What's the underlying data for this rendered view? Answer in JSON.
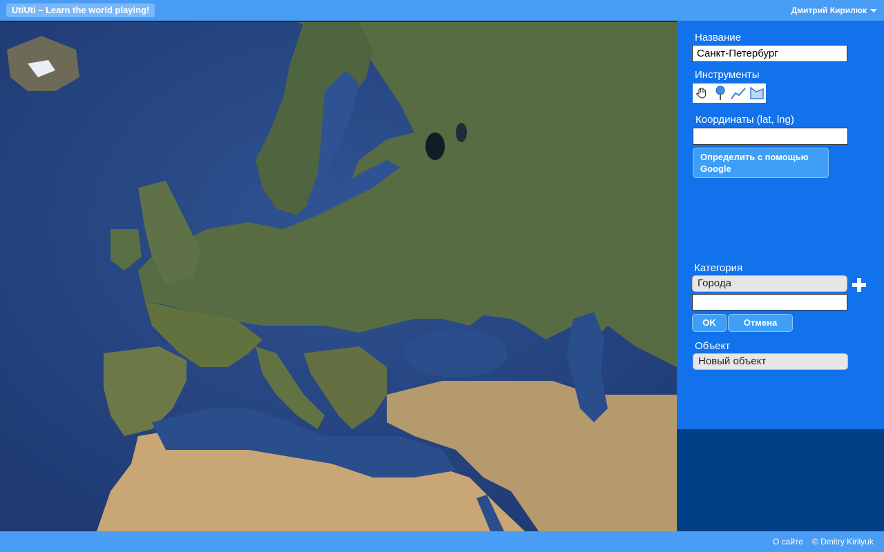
{
  "header": {
    "app_title": "UtiUti – Learn the world playing!",
    "user_name": "Дмитрий Кирилюк"
  },
  "panel": {
    "name_label": "Название",
    "name_value": "Санкт-Петербург",
    "tools_label": "Инструменты",
    "tools": [
      {
        "icon": "hand-icon",
        "label": "pan"
      },
      {
        "icon": "pin-icon",
        "label": "point"
      },
      {
        "icon": "polyline-icon",
        "label": "line"
      },
      {
        "icon": "polygon-icon",
        "label": "area"
      }
    ],
    "coords_label": "Координаты (lat, lng)",
    "coords_value": "",
    "geocode_button": "Определить с помощью Google",
    "category_label": "Категория",
    "category_selected": "Города",
    "category_new_value": "",
    "ok_button": "OK",
    "cancel_button": "Отмена",
    "object_label": "Объект",
    "object_selected": "Новый объект"
  },
  "footer": {
    "about_link": "О сайте",
    "copyright": "© Dmitry Kirilyuk"
  },
  "colors": {
    "header_bg": "#4a9df5",
    "panel_bg": "#1272ec",
    "panel_lower_bg": "#003f85",
    "sea": "#2b4a86",
    "land": "#5a6e45"
  }
}
